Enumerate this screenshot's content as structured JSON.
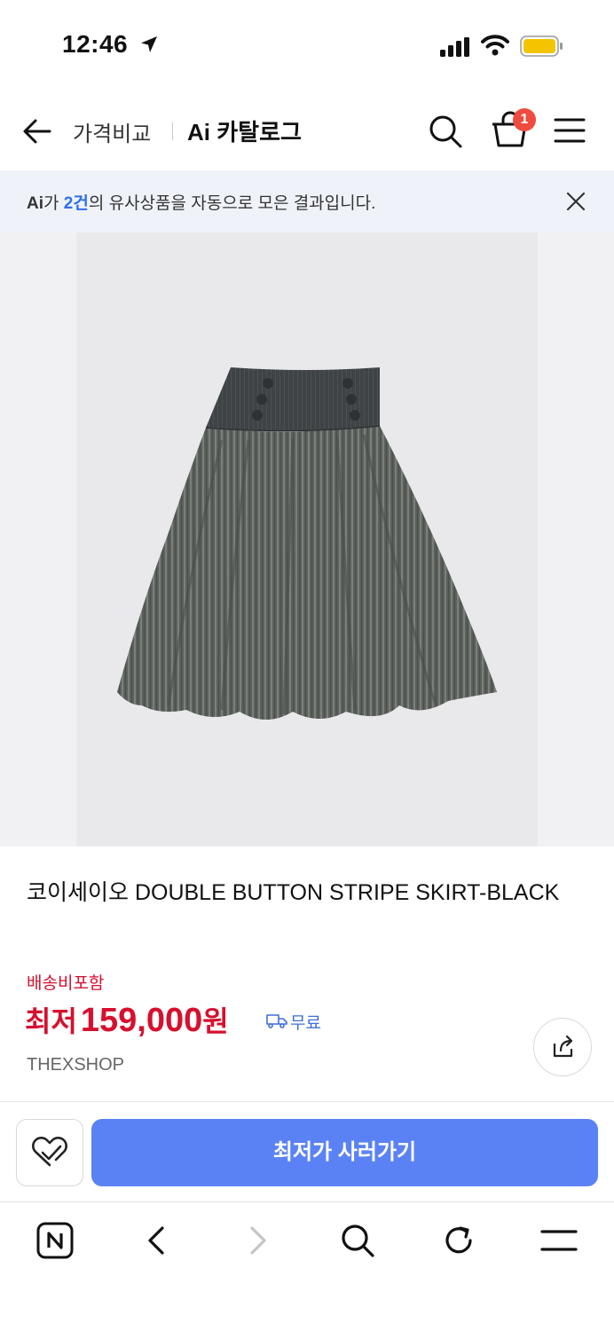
{
  "status_bar": {
    "time": "12:46",
    "icons": [
      "location-arrow-icon",
      "signal-icon",
      "wifi-icon",
      "battery-icon"
    ],
    "battery_color": "#f5c400"
  },
  "header": {
    "back_icon": "arrow-left-icon",
    "tab_price": "가격비교",
    "tab_catalog": "Ai 카탈로그",
    "cart_badge": "1",
    "icons": [
      "search-icon",
      "shopping-bag-icon",
      "hamburger-menu-icon"
    ]
  },
  "ai_banner": {
    "ai_mark": "Ai",
    "text_before": "가 ",
    "count": "2건",
    "text_after": "의 유사상품을 자동으로 모은 결과입니다.",
    "close_icon": "close-icon"
  },
  "product": {
    "image_alt": "skirt-image",
    "title": "코이세이오 DOUBLE BUTTON STRIPE SKIRT-BLACK",
    "shipping_label": "배송비포함",
    "price_prefix": "최저",
    "price_value": "159,000",
    "price_unit": "원",
    "free_shipping": "무료",
    "shop_name": "THEXSHOP",
    "price_color": "#d6102e"
  },
  "actions": {
    "wish_icon": "heart-check-icon",
    "buy_label": "최저가 사러가기",
    "buy_color": "#5b82f5",
    "share_icon": "share-icon"
  },
  "browser_toolbar": {
    "icons": [
      "naver-home-icon",
      "back-chevron-icon",
      "forward-chevron-icon",
      "search-icon",
      "reload-icon",
      "menu-icon"
    ]
  }
}
